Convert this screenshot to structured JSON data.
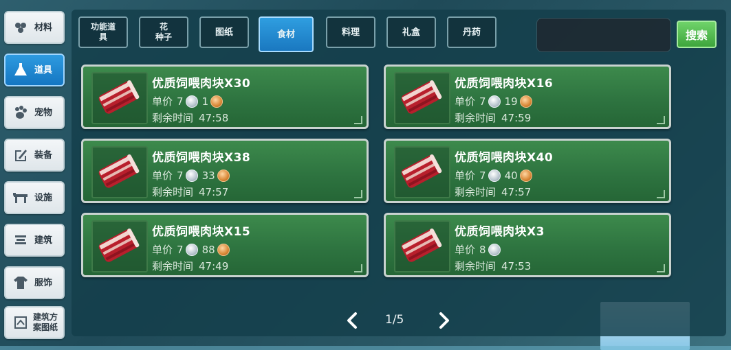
{
  "sidebar": {
    "items": [
      {
        "label": "材料",
        "icon": "materials-icon"
      },
      {
        "label": "道具",
        "icon": "tool-icon"
      },
      {
        "label": "宠物",
        "icon": "paw-icon"
      },
      {
        "label": "装备",
        "icon": "equipment-icon"
      },
      {
        "label": "设施",
        "icon": "facility-icon"
      },
      {
        "label": "建筑",
        "icon": "building-icon"
      },
      {
        "label": "服饰",
        "icon": "clothing-icon"
      },
      {
        "label": "建筑方\n案图纸",
        "icon": "blueprint-icon"
      }
    ],
    "active": "道具"
  },
  "tabs": [
    {
      "label": "功能道\n具"
    },
    {
      "label": "花\n种子"
    },
    {
      "label": "图纸"
    },
    {
      "label": "食材"
    },
    {
      "label": "料理"
    },
    {
      "label": "礼盒"
    },
    {
      "label": "丹药"
    }
  ],
  "active_tab": "食材",
  "search": {
    "button_label": "搜索",
    "value": ""
  },
  "labels": {
    "unit_price": "单价",
    "remaining_time": "剩余时间"
  },
  "listings": [
    {
      "name": "优质饲喂肉块X30",
      "silver": "7",
      "copper": "1",
      "time": "47:58"
    },
    {
      "name": "优质饲喂肉块X16",
      "silver": "7",
      "copper": "19",
      "time": "47:59"
    },
    {
      "name": "优质饲喂肉块X38",
      "silver": "7",
      "copper": "33",
      "time": "47:57"
    },
    {
      "name": "优质饲喂肉块X40",
      "silver": "7",
      "copper": "40",
      "time": "47:57"
    },
    {
      "name": "优质饲喂肉块X15",
      "silver": "7",
      "copper": "88",
      "time": "47:49"
    },
    {
      "name": "优质饲喂肉块X3",
      "silver": "8",
      "copper": "",
      "time": "47:53"
    }
  ],
  "pager": {
    "page": "1/5"
  }
}
